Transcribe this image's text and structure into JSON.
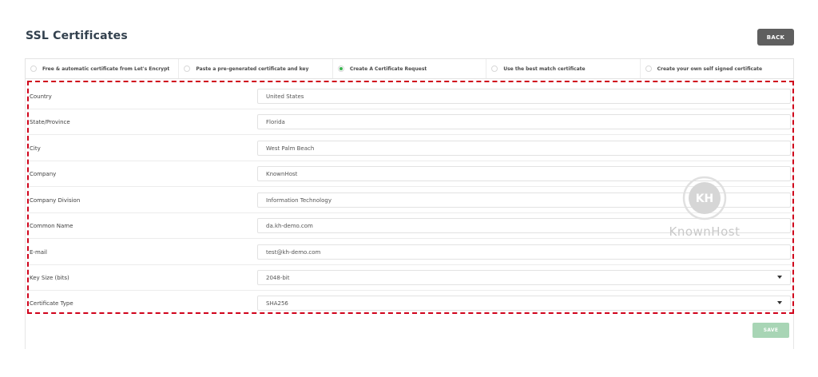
{
  "header": {
    "title": "SSL Certificates",
    "back_label": "BACK"
  },
  "tabs": [
    {
      "label": "Free & automatic certificate from Let's Encrypt",
      "selected": false
    },
    {
      "label": "Paste a pre-generated certificate and key",
      "selected": false
    },
    {
      "label": "Create A Certificate Request",
      "selected": true
    },
    {
      "label": "Use the best match certificate",
      "selected": false
    },
    {
      "label": "Create your own self signed certificate",
      "selected": false
    }
  ],
  "form": {
    "country": {
      "label": "Country",
      "value": "United States"
    },
    "state": {
      "label": "State/Province",
      "value": "Florida"
    },
    "city": {
      "label": "City",
      "value": "West Palm Beach"
    },
    "company": {
      "label": "Company",
      "value": "KnownHost"
    },
    "division": {
      "label": "Company Division",
      "value": "Information Technology"
    },
    "common_name": {
      "label": "Common Name",
      "value": "da.kh-demo.com"
    },
    "email": {
      "label": "E-mail",
      "value": "test@kh-demo.com"
    },
    "key_size": {
      "label": "Key Size (bits)",
      "value": "2048-bit"
    },
    "cert_type": {
      "label": "Certificate Type",
      "value": "SHA256"
    }
  },
  "actions": {
    "save_label": "SAVE"
  },
  "watermark": {
    "text": "KnownHost",
    "monogram": "KH"
  },
  "colors": {
    "accent_green": "#3bb552",
    "highlight_red": "#d0021b",
    "save_green": "#a8d5b5",
    "back_gray": "#5f5f5f"
  }
}
